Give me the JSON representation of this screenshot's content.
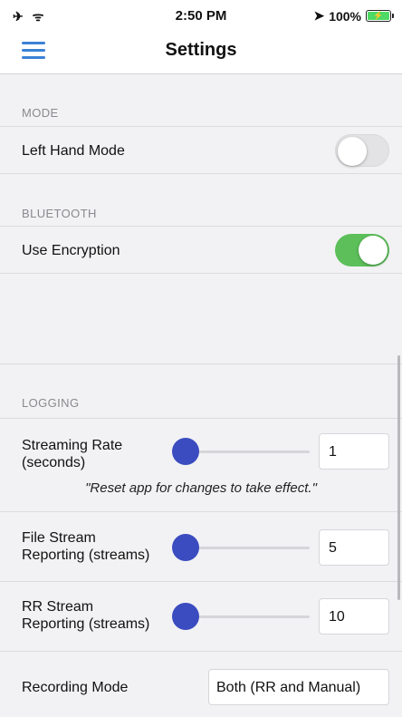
{
  "status_bar": {
    "left_icons": "✈ ᯤ",
    "time": "2:50 PM",
    "location_icon": "location-arrow-icon",
    "battery_percent": "100%",
    "battery_level": 1.0,
    "battery_charging": true
  },
  "nav": {
    "title": "Settings",
    "menu_icon": "hamburger-menu-icon",
    "menu_color": "#3b82d6"
  },
  "sections": {
    "mode": {
      "header": "MODE",
      "left_hand_mode": {
        "label": "Left Hand Mode",
        "enabled": false
      }
    },
    "bluetooth": {
      "header": "BLUETOOTH",
      "use_encryption": {
        "label": "Use Encryption",
        "enabled": true,
        "on_color": "#5cbf5a"
      }
    },
    "logging": {
      "header": "LOGGING",
      "streaming_rate": {
        "label_line1": "Streaming Rate",
        "label_line2": "(seconds)",
        "value": "1",
        "slider_fraction": 0.0,
        "note": "\"Reset app for changes to take effect.\""
      },
      "file_stream": {
        "label_line1": "File Stream",
        "label_line2": "Reporting (streams)",
        "value": "5",
        "slider_fraction": 0.0
      },
      "rr_stream": {
        "label_line1": "RR Stream",
        "label_line2": "Reporting (streams)",
        "value": "10",
        "slider_fraction": 0.0
      },
      "recording_mode": {
        "label": "Recording Mode",
        "value": "Both (RR and Manual)"
      }
    }
  },
  "colors": {
    "slider_thumb": "#3b4cc0",
    "background": "#f2f2f4"
  }
}
